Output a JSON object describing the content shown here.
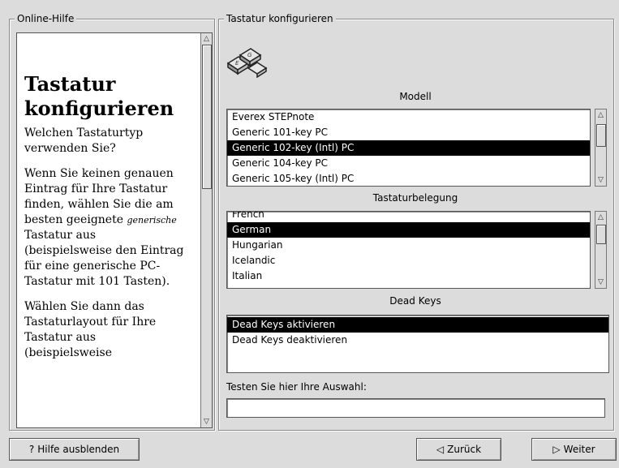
{
  "help_panel": {
    "title": "Online-Hilfe",
    "heading": "Tastatur konfigurieren",
    "para1": "Welchen Tastaturtyp verwenden Sie?",
    "para2_a": "Wenn Sie keinen genauen Eintrag für Ihre Tastatur finden, wählen Sie die am besten geeignete",
    "para2_ital": "generische",
    "para2_b": "Tastatur aus (beispielsweise den Eintrag für eine generische PC-Tastatur mit 101 Tasten).",
    "para3": "Wählen Sie dann das Tastaturlayout für Ihre Tastatur aus (beispielsweise"
  },
  "config_panel": {
    "title": "Tastatur konfigurieren",
    "icon": "keyboard-icon",
    "model": {
      "label": "Modell",
      "items": [
        "Everex STEPnote",
        "Generic 101-key PC",
        "Generic 102-key (Intl) PC",
        "Generic 104-key PC",
        "Generic 105-key (Intl) PC"
      ],
      "selected_index": 2
    },
    "layout": {
      "label": "Tastaturbelegung",
      "items": [
        "French",
        "German",
        "Hungarian",
        "Icelandic",
        "Italian"
      ],
      "selected_index": 1
    },
    "deadkeys": {
      "label": "Dead Keys",
      "items": [
        "Dead Keys aktivieren",
        "Dead Keys deaktivieren"
      ],
      "selected_index": 0
    },
    "test": {
      "label": "Testen Sie hier Ihre Auswahl:",
      "value": ""
    }
  },
  "buttons": {
    "hide_help": "Hilfe ausblenden",
    "back": "Zurück",
    "next": "Weiter"
  }
}
